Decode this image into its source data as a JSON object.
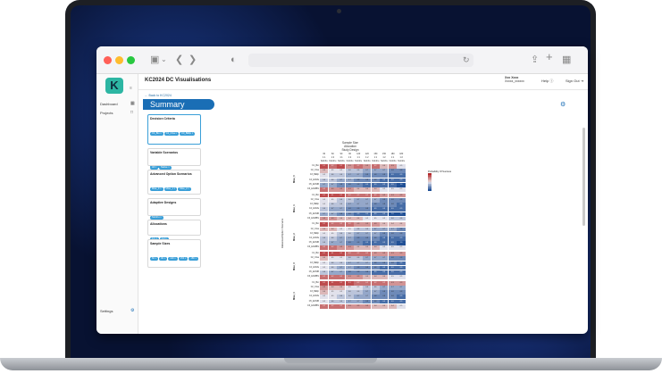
{
  "browser": {
    "traffic_lights": [
      "#ff5f57",
      "#febc2e",
      "#28c840"
    ]
  },
  "app": {
    "title": "KC2024 DC Visualisations",
    "logo_letter": "K",
    "accent": "#1a6eb5",
    "user_name": "Xxx Xxxx",
    "user_sub": "Xxxxx_xxxxxx",
    "help_label": "Help",
    "signout_label": "Sign Out"
  },
  "sidebar": {
    "items": [
      {
        "label": "Dashboard",
        "icon": "grid-icon"
      },
      {
        "label": "Projects",
        "icon": "folder-icon"
      }
    ],
    "settings_label": "Settings"
  },
  "page": {
    "back_label": "Back to KC2024",
    "heading": "Summary"
  },
  "filters": [
    {
      "title": "Decision Criteria",
      "chips": [
        "C1_Bio",
        "C2_CGa",
        "C3_BEfip",
        "C4_ECMa",
        "C5_ECMB",
        "C6_ECMBN"
      ]
    },
    {
      "title": "Variable Scenarios",
      "chips": [
        "All",
        "Native"
      ]
    },
    {
      "title": "Advanced Option Scenarios",
      "chips": [
        "Mise_0",
        "Mise_1",
        "Mise_2"
      ]
    },
    {
      "title": "Adaptive Designs",
      "chips": [
        "NoInFu"
      ]
    },
    {
      "title": "Allocations",
      "chips": [
        "1:1",
        "1:2"
      ]
    },
    {
      "title": "Sample Sizes",
      "chips": [
        "60",
        "90",
        "120",
        "150",
        "180"
      ]
    }
  ],
  "chart_data": {
    "type": "heatmap",
    "title": "Sample Size",
    "subtitle1": "Allocation",
    "subtitle2": "Study Design",
    "legend_title": "Probability Of Success",
    "columns": [
      {
        "size": "60",
        "alloc": "1:1",
        "design": "NoInFu"
      },
      {
        "size": "60",
        "alloc": "1:2",
        "design": "NoInFu"
      },
      {
        "size": "90",
        "alloc": "1:1",
        "design": "NoInFu"
      },
      {
        "size": "90",
        "alloc": "1:2",
        "design": "NoInFu"
      },
      {
        "size": "120",
        "alloc": "1:1",
        "design": "NoInFu"
      },
      {
        "size": "120",
        "alloc": "1:2",
        "design": "NoInFu"
      },
      {
        "size": "150",
        "alloc": "1:1",
        "design": "NoInFu"
      },
      {
        "size": "150",
        "alloc": "1:2",
        "design": "NoInFu"
      },
      {
        "size": "180",
        "alloc": "1:1",
        "design": "NoInFu"
      },
      {
        "size": "180",
        "alloc": "1:2",
        "design": "NoInFu"
      }
    ],
    "y_axis_label": "Advanced Option Scenario",
    "groups": [
      "Mise_0",
      "Mise_1",
      "Mise_2",
      "Mise_3",
      "Mise_4"
    ],
    "row_labels": [
      "C1_Bio",
      "C2_CGa",
      "C3_BEfip",
      "C4_ECMa",
      "C5_ECMB",
      "C6_ECMBN"
    ],
    "values": [
      [
        0.1,
        0.2,
        0.1,
        0.3,
        0.2,
        0.3,
        0.2,
        0.4,
        0.3,
        0.5
      ],
      [
        0.4,
        0.5,
        0.5,
        0.6,
        0.6,
        0.7,
        0.7,
        0.7,
        0.8,
        0.8
      ],
      [
        0.5,
        0.6,
        0.6,
        0.7,
        0.7,
        0.8,
        0.8,
        0.8,
        0.9,
        0.9
      ],
      [
        0.6,
        0.6,
        0.7,
        0.7,
        0.8,
        0.8,
        0.8,
        0.9,
        0.9,
        0.9
      ],
      [
        0.7,
        0.7,
        0.8,
        0.8,
        0.8,
        0.9,
        0.9,
        0.9,
        0.9,
        1.0
      ],
      [
        0.2,
        0.3,
        0.3,
        0.3,
        0.4,
        0.4,
        0.4,
        0.5,
        0.5,
        0.5
      ],
      [
        0.1,
        0.1,
        0.1,
        0.2,
        0.2,
        0.2,
        0.2,
        0.3,
        0.3,
        0.3
      ],
      [
        0.5,
        0.5,
        0.6,
        0.6,
        0.7,
        0.7,
        0.7,
        0.8,
        0.8,
        0.8
      ],
      [
        0.5,
        0.6,
        0.6,
        0.7,
        0.7,
        0.7,
        0.8,
        0.8,
        0.8,
        0.9
      ],
      [
        0.6,
        0.7,
        0.7,
        0.8,
        0.8,
        0.8,
        0.9,
        0.9,
        0.9,
        0.9
      ],
      [
        0.7,
        0.7,
        0.8,
        0.8,
        0.9,
        0.9,
        0.9,
        0.9,
        1.0,
        1.0
      ],
      [
        0.3,
        0.3,
        0.4,
        0.4,
        0.4,
        0.5,
        0.5,
        0.5,
        0.6,
        0.6
      ],
      [
        0.1,
        0.2,
        0.2,
        0.2,
        0.3,
        0.3,
        0.3,
        0.4,
        0.4,
        0.4
      ],
      [
        0.4,
        0.4,
        0.5,
        0.5,
        0.6,
        0.6,
        0.7,
        0.7,
        0.7,
        0.8
      ],
      [
        0.5,
        0.5,
        0.6,
        0.6,
        0.7,
        0.7,
        0.7,
        0.8,
        0.8,
        0.8
      ],
      [
        0.6,
        0.6,
        0.7,
        0.7,
        0.8,
        0.8,
        0.8,
        0.9,
        0.9,
        0.9
      ],
      [
        0.6,
        0.7,
        0.7,
        0.8,
        0.8,
        0.9,
        0.9,
        0.9,
        0.9,
        1.0
      ],
      [
        0.2,
        0.2,
        0.3,
        0.3,
        0.4,
        0.4,
        0.4,
        0.5,
        0.5,
        0.5
      ],
      [
        0.1,
        0.1,
        0.1,
        0.2,
        0.2,
        0.2,
        0.3,
        0.3,
        0.3,
        0.3
      ],
      [
        0.4,
        0.5,
        0.5,
        0.6,
        0.6,
        0.7,
        0.7,
        0.7,
        0.8,
        0.8
      ],
      [
        0.5,
        0.6,
        0.6,
        0.7,
        0.7,
        0.7,
        0.8,
        0.8,
        0.8,
        0.9
      ],
      [
        0.5,
        0.6,
        0.7,
        0.7,
        0.8,
        0.8,
        0.8,
        0.9,
        0.9,
        0.9
      ],
      [
        0.6,
        0.7,
        0.7,
        0.8,
        0.8,
        0.8,
        0.9,
        0.9,
        0.9,
        0.9
      ],
      [
        0.2,
        0.2,
        0.2,
        0.3,
        0.3,
        0.4,
        0.4,
        0.4,
        0.5,
        0.5
      ],
      [
        0.1,
        0.1,
        0.1,
        0.1,
        0.2,
        0.2,
        0.2,
        0.2,
        0.3,
        0.3
      ],
      [
        0.3,
        0.4,
        0.4,
        0.5,
        0.5,
        0.6,
        0.6,
        0.7,
        0.7,
        0.7
      ],
      [
        0.4,
        0.5,
        0.5,
        0.6,
        0.6,
        0.7,
        0.7,
        0.8,
        0.8,
        0.8
      ],
      [
        0.5,
        0.5,
        0.6,
        0.6,
        0.7,
        0.7,
        0.8,
        0.8,
        0.8,
        0.9
      ],
      [
        0.5,
        0.6,
        0.6,
        0.7,
        0.7,
        0.8,
        0.8,
        0.9,
        0.9,
        0.9
      ],
      [
        0.2,
        0.2,
        0.2,
        0.3,
        0.3,
        0.3,
        0.4,
        0.4,
        0.4,
        0.5
      ]
    ]
  }
}
